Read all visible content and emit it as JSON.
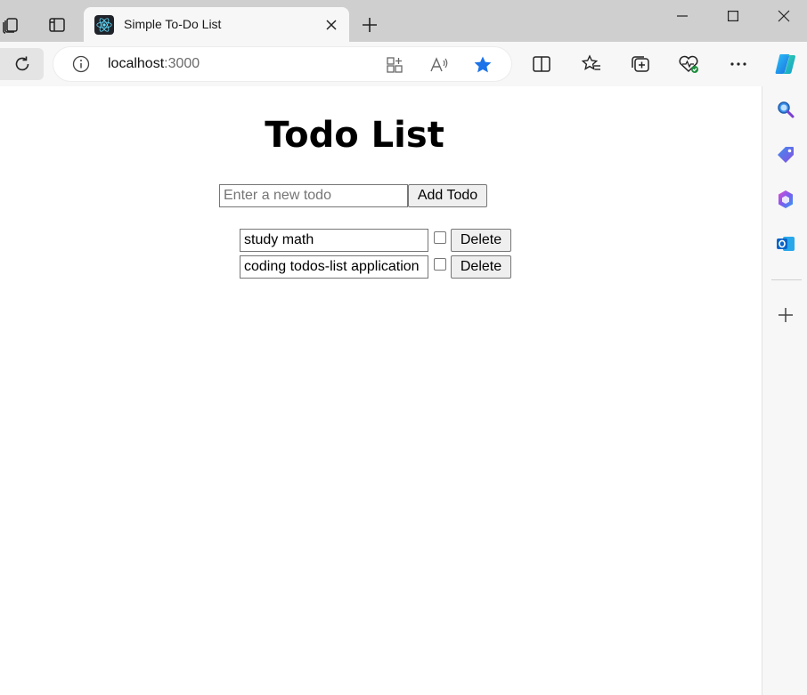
{
  "browser": {
    "tab_title": "Simple To-Do List",
    "address_host": "localhost",
    "address_port": ":3000"
  },
  "page": {
    "title": "Todo List",
    "new_todo_placeholder": "Enter a new todo",
    "add_button_label": "Add Todo",
    "todos": [
      {
        "text": "study math",
        "completed": false,
        "delete_label": "Delete"
      },
      {
        "text": "coding todos-list application",
        "completed": false,
        "delete_label": "Delete"
      }
    ]
  },
  "colors": {
    "accent_star": "#1a73e8"
  }
}
